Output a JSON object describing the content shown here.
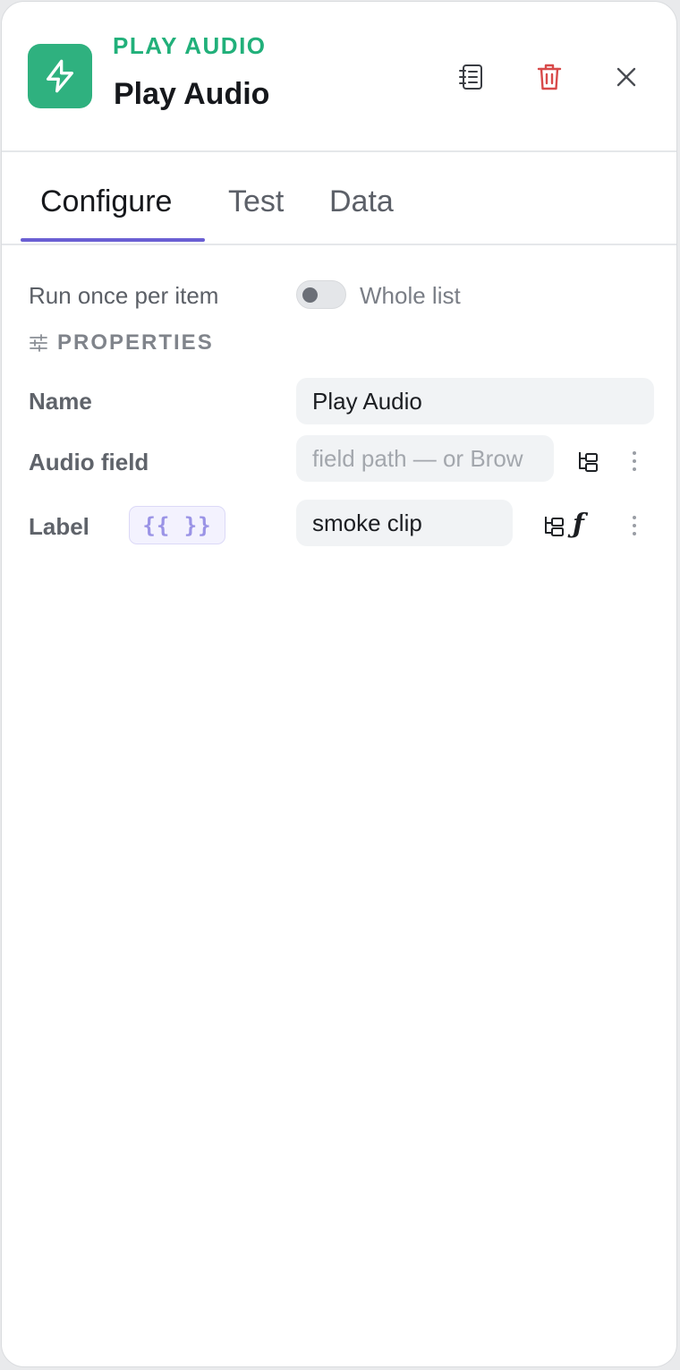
{
  "header": {
    "kicker": "PLAY AUDIO",
    "title": "Play Audio",
    "icon": "lightning-icon",
    "accent_color": "#2fb17f"
  },
  "tabs": [
    {
      "label": "Configure",
      "active": true
    },
    {
      "label": "Test",
      "active": false
    },
    {
      "label": "Data",
      "active": false
    }
  ],
  "run_mode": {
    "label": "Run once per item",
    "toggle_text": "Whole list",
    "toggle_on": false
  },
  "properties": {
    "section_title": "PROPERTIES",
    "name": {
      "label": "Name",
      "value": "Play Audio"
    },
    "audio_field": {
      "label": "Audio field",
      "placeholder": "field path — or Brow"
    },
    "label_field": {
      "label": "Label",
      "value": "smoke clip",
      "template_badge": "{{ }}",
      "fx_symbol": "ƒ"
    }
  },
  "colors": {
    "accent": "#21b07a",
    "tab_underline": "#6a5fd3",
    "delete": "#d84a4a"
  }
}
